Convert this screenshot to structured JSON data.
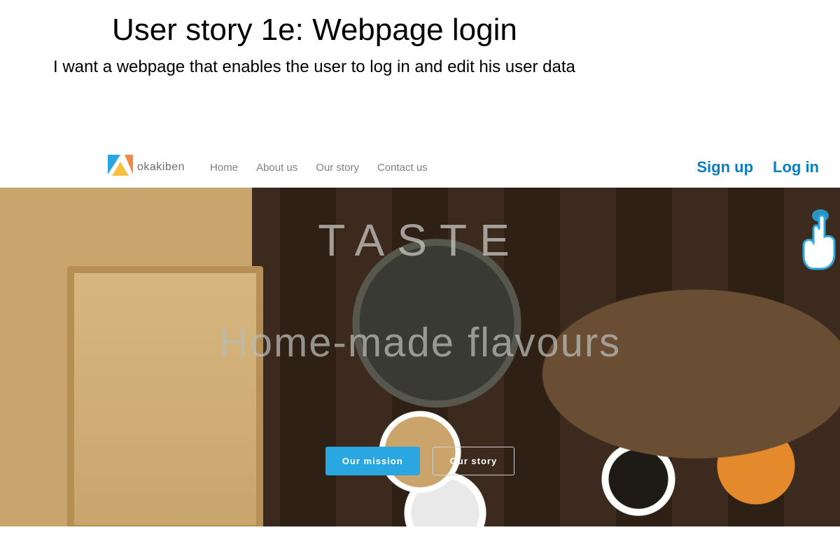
{
  "slide": {
    "title": "User story 1e: Webpage login",
    "description": "I want a webpage that enables the user to log in and edit his user data"
  },
  "header": {
    "brand": "okakiben",
    "nav": {
      "home": "Home",
      "about": "About us",
      "story": "Our story",
      "contact": "Contact us"
    },
    "auth": {
      "signup": "Sign up",
      "login": "Log in"
    }
  },
  "hero": {
    "title": "TASTE",
    "subtitle": "Home-made flavours",
    "buttons": {
      "mission": "Our mission",
      "story": "Our story"
    }
  },
  "colors": {
    "accent": "#2aa7e0",
    "link_auth": "#0a7fbf",
    "nav_text": "#808080"
  }
}
